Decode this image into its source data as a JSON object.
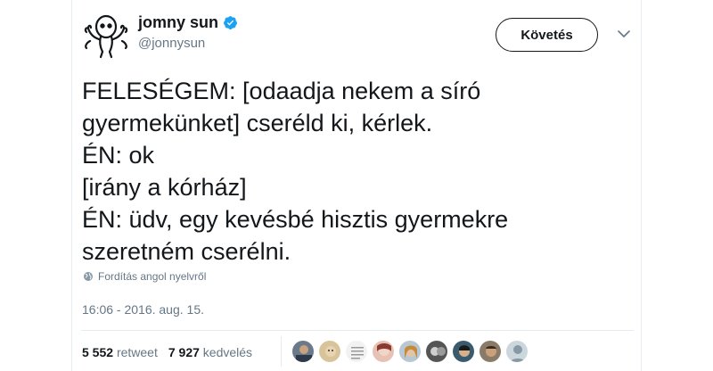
{
  "user": {
    "display_name": "jomny sun",
    "handle": "@jonnysun",
    "verified_icon": "verified-badge-icon",
    "avatar_icon": "cartoon-alien-avatar-icon"
  },
  "follow_button": {
    "label": "Követés"
  },
  "menu_icon": "chevron-down-icon",
  "tweet": {
    "lines": [
      "FELESÉGEM: [odaadja nekem a síró",
      "gyermekünket] cseréld ki, kérlek.",
      "ÉN: ok",
      "[irány a kórház]",
      "ÉN: üdv, egy kevésbé hisztis gyermekre",
      "szeretném cserélni."
    ]
  },
  "translate": {
    "label": "Fordítás angol nyelvről",
    "icon": "globe-icon"
  },
  "timestamp": "16:06 - 2016. aug. 15.",
  "stats": {
    "retweet_count": "5 552",
    "retweet_label": "retweet",
    "like_count": "7 927",
    "like_label": "kedvelés"
  },
  "colors": {
    "accent": "#1da1f2",
    "text": "#14171a",
    "secondary": "#657786",
    "border": "#e6ecf0"
  }
}
